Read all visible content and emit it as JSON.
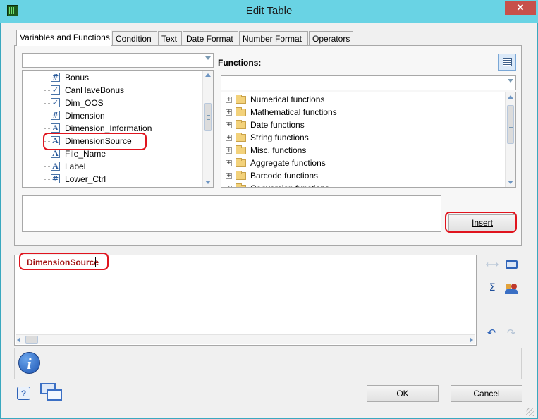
{
  "window": {
    "title": "Edit Table",
    "close_glyph": "✕",
    "icon": "table-app-icon"
  },
  "tabs": [
    {
      "label": "Variables and Functions",
      "active": true
    },
    {
      "label": "Condition"
    },
    {
      "label": "Text"
    },
    {
      "label": "Date Format"
    },
    {
      "label": "Number Format"
    },
    {
      "label": "Operators"
    }
  ],
  "variables": {
    "filter_value": "",
    "items": [
      {
        "label": "Bonus",
        "icon": "#",
        "type": "number"
      },
      {
        "label": "CanHaveBonus",
        "icon": "✓",
        "type": "boolean"
      },
      {
        "label": "Dim_OOS",
        "icon": "✓",
        "type": "boolean"
      },
      {
        "label": "Dimension",
        "icon": "#",
        "type": "number"
      },
      {
        "label": "Dimension_Information",
        "icon": "A",
        "type": "text"
      },
      {
        "label": "DimensionSource",
        "icon": "A",
        "type": "text",
        "selected": true
      },
      {
        "label": "File_Name",
        "icon": "A",
        "type": "text"
      },
      {
        "label": "Label",
        "icon": "A",
        "type": "text"
      },
      {
        "label": "Lower_Ctrl",
        "icon": "#",
        "type": "number"
      }
    ]
  },
  "functions": {
    "heading": "Functions:",
    "filter_value": "",
    "expander": "+",
    "items": [
      "Numerical functions",
      "Mathematical functions",
      "Date functions",
      "String functions",
      "Misc. functions",
      "Aggregate functions",
      "Barcode functions",
      "Conversion functions"
    ]
  },
  "description_text": "",
  "insert_button": {
    "label": "Insert"
  },
  "formula": {
    "value": "DimensionSource"
  },
  "side_tools": {
    "wrap": "⟷",
    "sum": "Σ",
    "undo": "↶",
    "redo": "↷"
  },
  "footer": {
    "info_glyph": "i",
    "help_glyph": "?",
    "ok_label": "OK",
    "cancel_label": "Cancel"
  },
  "colors": {
    "titlebar": "#69d3e4",
    "highlight": "#e0141e",
    "accent": "#2a5a9a"
  }
}
